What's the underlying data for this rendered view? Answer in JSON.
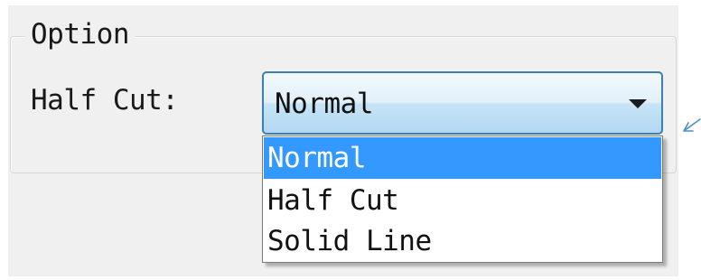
{
  "group": {
    "title": "Option"
  },
  "field": {
    "label": "Half Cut:"
  },
  "combo": {
    "value": "Normal",
    "icon": "chevron-down-icon"
  },
  "dropdown": {
    "options": [
      {
        "label": "Normal",
        "selected": true
      },
      {
        "label": "Half Cut",
        "selected": false
      },
      {
        "label": "Solid Line",
        "selected": false
      }
    ]
  },
  "colors": {
    "selection": "#3399ff",
    "combo_border": "#3c7fb1",
    "annotation_arrow": "#4a90c8"
  }
}
